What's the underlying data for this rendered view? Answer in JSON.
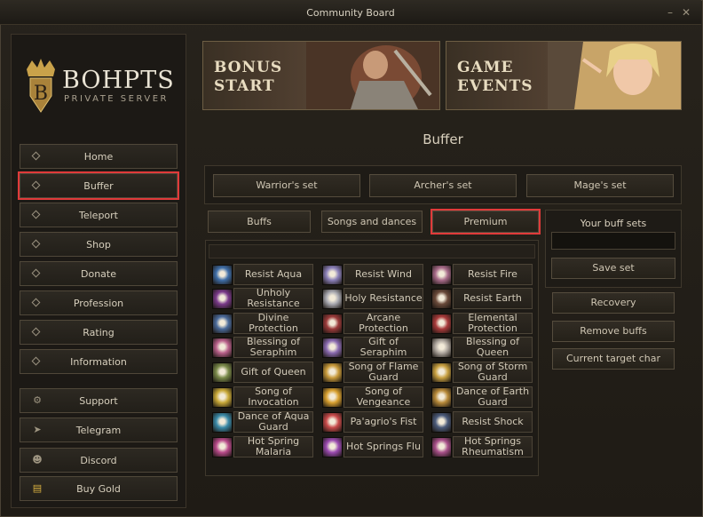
{
  "window": {
    "title": "Community Board",
    "minimize": "–",
    "close": "✕"
  },
  "logo": {
    "name": "BOHPTS",
    "subtitle": "PRIVATE SERVER"
  },
  "nav": {
    "items": [
      {
        "label": "Home",
        "icon": "diamond-icon"
      },
      {
        "label": "Buffer",
        "icon": "diamond-icon"
      },
      {
        "label": "Teleport",
        "icon": "diamond-icon"
      },
      {
        "label": "Shop",
        "icon": "diamond-icon"
      },
      {
        "label": "Donate",
        "icon": "diamond-icon"
      },
      {
        "label": "Profession",
        "icon": "diamond-icon"
      },
      {
        "label": "Rating",
        "icon": "diamond-icon"
      },
      {
        "label": "Information",
        "icon": "diamond-icon"
      }
    ],
    "links": [
      {
        "label": "Support",
        "icon": "gear-icon"
      },
      {
        "label": "Telegram",
        "icon": "telegram-icon"
      },
      {
        "label": "Discord",
        "icon": "discord-icon"
      },
      {
        "label": "Buy Gold",
        "icon": "gold-icon"
      }
    ]
  },
  "banners": {
    "left": [
      "BONUS",
      "START"
    ],
    "right": [
      "GAME",
      "EVENTS"
    ]
  },
  "buffer": {
    "title": "Buffer",
    "sets": [
      "Warrior's set",
      "Archer's set",
      "Mage's set"
    ],
    "tabs": [
      "Buffs",
      "Songs and dances",
      "Premium"
    ],
    "buffs": [
      [
        "Resist Aqua",
        "Resist Wind",
        "Resist Fire"
      ],
      [
        "Unholy Resistance",
        "Holy Resistance",
        "Resist Earth"
      ],
      [
        "Divine Protection",
        "Arcane Protection",
        "Elemental Protection"
      ],
      [
        "Blessing of Seraphim",
        "Gift of Seraphim",
        "Blessing of Queen"
      ],
      [
        "Gift of Queen",
        "Song of Flame Guard",
        "Song of Storm Guard"
      ],
      [
        "Song of Invocation",
        "Song of Vengeance",
        "Dance of Earth Guard"
      ],
      [
        "Dance of Aqua Guard",
        "Pa'agrio's Fist",
        "Resist Shock"
      ],
      [
        "Hot Spring Malaria",
        "Hot Springs Flu",
        "Hot Springs Rheumatism"
      ]
    ],
    "icon_colors": [
      [
        "#3f6ea8",
        "#8a7fb8",
        "#a86b8a"
      ],
      [
        "#7a3a8a",
        "#a8a8b0",
        "#6a4a3a"
      ],
      [
        "#4a6a9a",
        "#9a3a3a",
        "#a83a3a"
      ],
      [
        "#b8608a",
        "#8a6ab0",
        "#b0a8a0"
      ],
      [
        "#7a8a4a",
        "#c89a3a",
        "#c8a040"
      ],
      [
        "#c8a838",
        "#d8a030",
        "#b88a3a"
      ],
      [
        "#3a8aa8",
        "#c84a4a",
        "#4a5a7a"
      ],
      [
        "#b84a8a",
        "#9a4ab0",
        "#a8508a"
      ]
    ]
  },
  "buff_sets": {
    "title": "Your buff sets",
    "input_value": "",
    "save_label": "Save set",
    "actions": [
      "Recovery",
      "Remove buffs",
      "Current target char"
    ]
  }
}
